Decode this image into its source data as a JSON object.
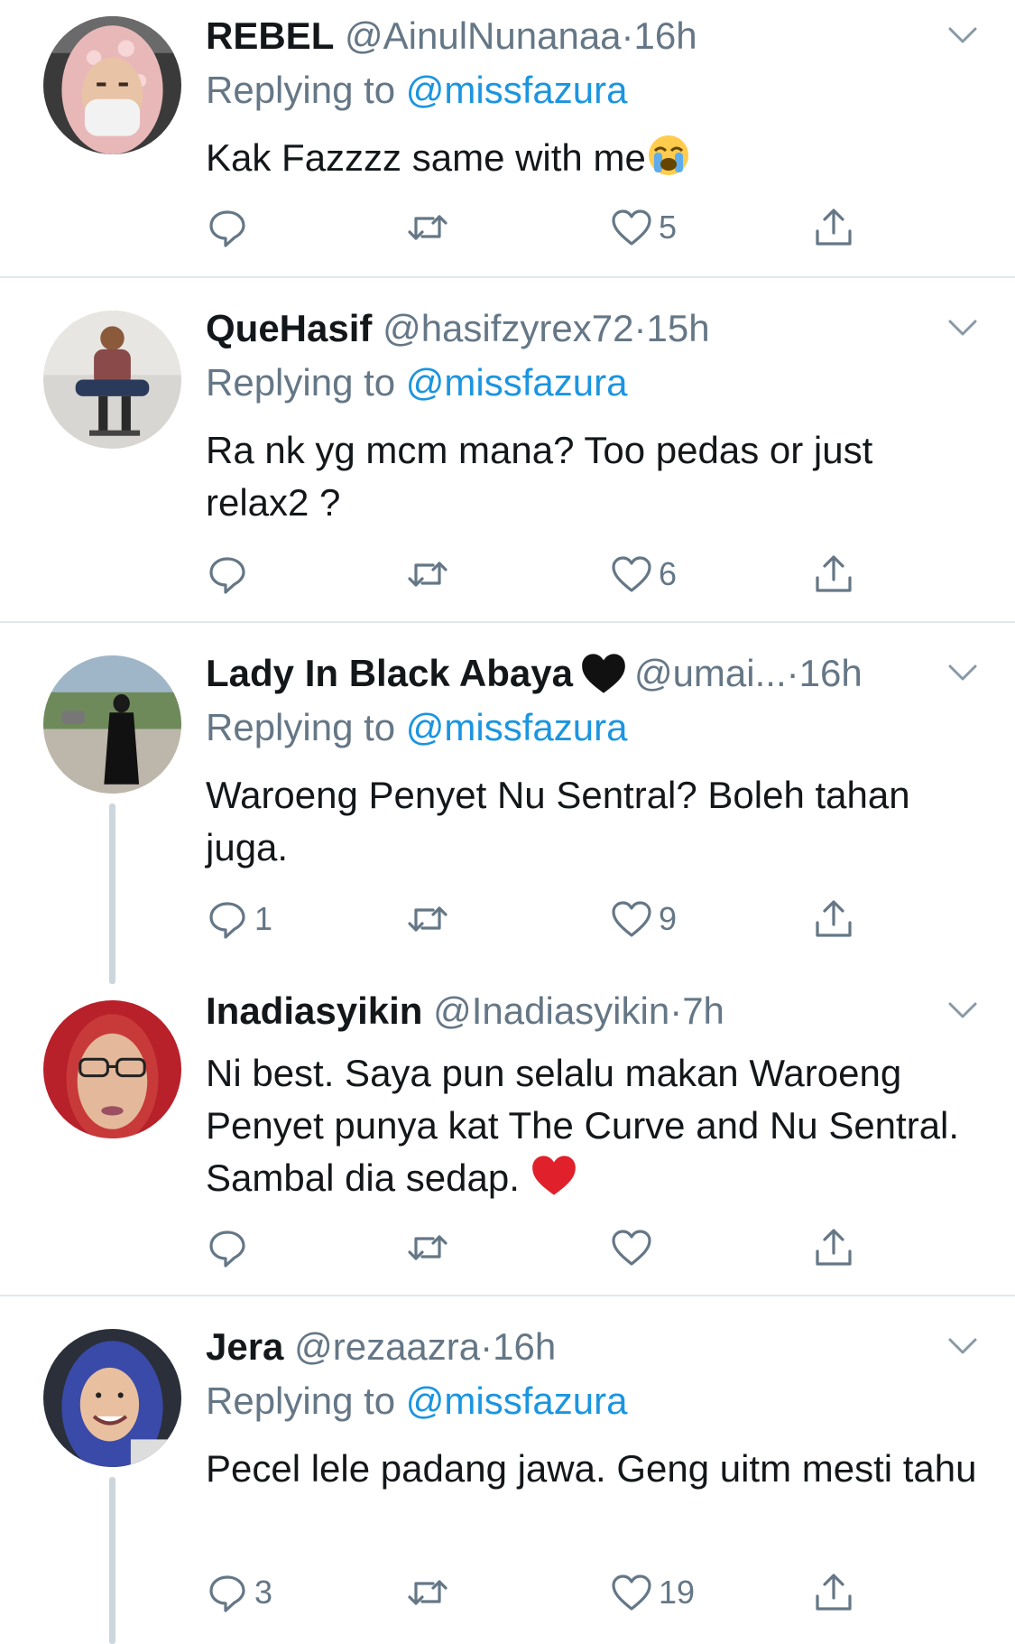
{
  "tweets": [
    {
      "name": "REBEL",
      "handle": "@AinulNunanaa",
      "dot": "·",
      "time": "16h",
      "reply_prefix": "Replying to",
      "reply_mention": "@missfazura",
      "text": "Kak Fazzzz same with me",
      "text_emoji": "loudly-crying-face",
      "replies": "",
      "likes": "5"
    },
    {
      "name": "QueHasif",
      "handle": "@hasifzyrex72",
      "dot": "·",
      "time": "15h",
      "reply_prefix": "Replying to",
      "reply_mention": "@missfazura",
      "text": "Ra nk yg mcm mana? Too pedas or just relax2 ?",
      "replies": "",
      "likes": "6"
    },
    {
      "name": "Lady In Black Abaya",
      "name_emoji": "black-heart",
      "handle": "@umai...",
      "dot": "·",
      "time": "16h",
      "reply_prefix": "Replying to",
      "reply_mention": "@missfazura",
      "text": "Waroeng Penyet Nu Sentral? Boleh tahan juga.",
      "replies": "1",
      "likes": "9"
    },
    {
      "name": "Inadiasyikin",
      "handle": "@Inadiasyikin",
      "dot": "·",
      "time": "7h",
      "text": "Ni best. Saya pun selalu makan Waroeng Penyet punya kat The Curve and Nu Sentral. Sambal dia sedap.",
      "text_emoji": "red-heart",
      "replies": "",
      "likes": ""
    },
    {
      "name": "Jera",
      "handle": "@rezaazra",
      "dot": "·",
      "time": "16h",
      "reply_prefix": "Replying to",
      "reply_mention": "@missfazura",
      "text": "Pecel lele padang jawa. Geng uitm mesti tahu",
      "replies": "3",
      "likes": "19"
    }
  ],
  "icons": {
    "reply": "reply-icon",
    "retweet": "retweet-icon",
    "like": "heart-icon",
    "share": "share-icon",
    "caret": "chevron-down-icon"
  },
  "colors": {
    "text": "#14171a",
    "secondary": "#657786",
    "link": "#1b95e0",
    "divider": "#e1e8ed",
    "thread_line": "#ccd6dd"
  }
}
